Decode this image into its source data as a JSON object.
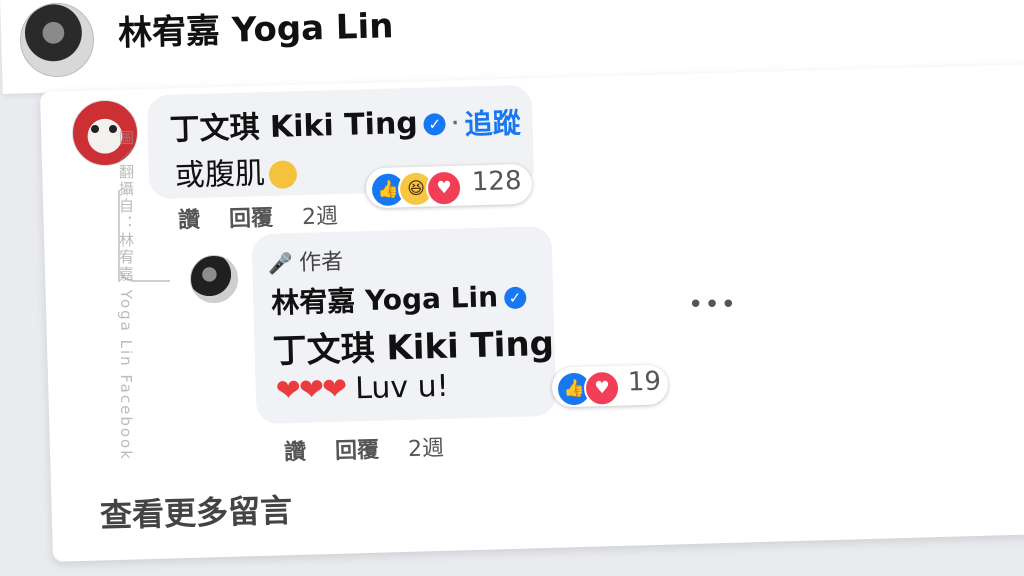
{
  "post": {
    "author": "林宥嘉 Yoga Lin"
  },
  "comment1": {
    "name": "丁文琪 Kiki Ting",
    "verified_icon": "verified-check-icon",
    "separator": "·",
    "follow_label": "追蹤",
    "text": "或腹肌",
    "text_emoji": "face-with-hand-over-mouth-emoji",
    "reactions": [
      "like",
      "haha",
      "love"
    ],
    "reaction_count": "128",
    "actions": {
      "like": "讚",
      "reply": "回覆",
      "time": "2週"
    }
  },
  "reply1": {
    "author_tag": "作者",
    "author_tag_icon": "microphone-icon",
    "name": "林宥嘉 Yoga Lin",
    "mention": "丁文琪 Kiki Ting",
    "text": "Luv u!",
    "hearts": "❤❤❤",
    "reactions": [
      "like",
      "love"
    ],
    "reaction_count": "19",
    "more_options": "•••",
    "actions": {
      "like": "讚",
      "reply": "回覆",
      "time": "2週"
    }
  },
  "footer": {
    "see_more": "查看更多留言"
  },
  "watermark": "圖／翻攝自：林宥嘉 Yoga Lin Facebook",
  "colors": {
    "accent": "#1877f2",
    "bubble": "#f0f2f5",
    "love": "#f33e58",
    "haha": "#f7c744"
  }
}
